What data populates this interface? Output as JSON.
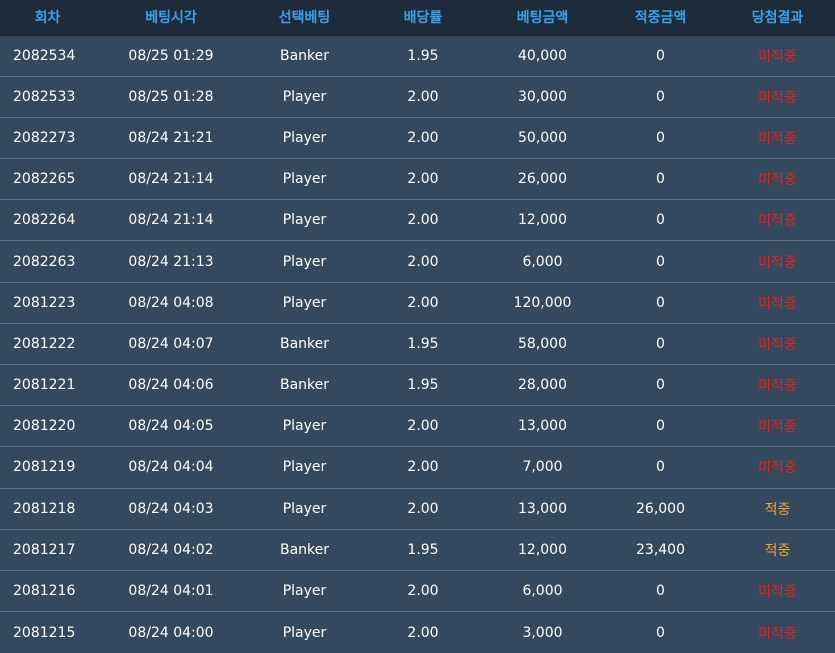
{
  "colors": {
    "header_text": "#3aa3e8",
    "header_bg": "#1d2b3b",
    "row_bg": "#34495e",
    "row_border": "#5d7285",
    "text": "#ffffff",
    "lose": "#e02424",
    "win": "#f0a52c"
  },
  "table": {
    "headers": [
      "회차",
      "베팅시각",
      "선택베팅",
      "배당률",
      "베팅금액",
      "적중금액",
      "당첨결과"
    ],
    "rows": [
      {
        "round": "2082534",
        "time": "08/25 01:29",
        "pick": "Banker",
        "odds": "1.95",
        "bet": "40,000",
        "win": "0",
        "result": "미적중",
        "status": "lose"
      },
      {
        "round": "2082533",
        "time": "08/25 01:28",
        "pick": "Player",
        "odds": "2.00",
        "bet": "30,000",
        "win": "0",
        "result": "미적중",
        "status": "lose"
      },
      {
        "round": "2082273",
        "time": "08/24 21:21",
        "pick": "Player",
        "odds": "2.00",
        "bet": "50,000",
        "win": "0",
        "result": "미적중",
        "status": "lose"
      },
      {
        "round": "2082265",
        "time": "08/24 21:14",
        "pick": "Player",
        "odds": "2.00",
        "bet": "26,000",
        "win": "0",
        "result": "미적중",
        "status": "lose"
      },
      {
        "round": "2082264",
        "time": "08/24 21:14",
        "pick": "Player",
        "odds": "2.00",
        "bet": "12,000",
        "win": "0",
        "result": "미적중",
        "status": "lose"
      },
      {
        "round": "2082263",
        "time": "08/24 21:13",
        "pick": "Player",
        "odds": "2.00",
        "bet": "6,000",
        "win": "0",
        "result": "미적중",
        "status": "lose"
      },
      {
        "round": "2081223",
        "time": "08/24 04:08",
        "pick": "Player",
        "odds": "2.00",
        "bet": "120,000",
        "win": "0",
        "result": "미적중",
        "status": "lose"
      },
      {
        "round": "2081222",
        "time": "08/24 04:07",
        "pick": "Banker",
        "odds": "1.95",
        "bet": "58,000",
        "win": "0",
        "result": "미적중",
        "status": "lose"
      },
      {
        "round": "2081221",
        "time": "08/24 04:06",
        "pick": "Banker",
        "odds": "1.95",
        "bet": "28,000",
        "win": "0",
        "result": "미적중",
        "status": "lose"
      },
      {
        "round": "2081220",
        "time": "08/24 04:05",
        "pick": "Player",
        "odds": "2.00",
        "bet": "13,000",
        "win": "0",
        "result": "미적중",
        "status": "lose"
      },
      {
        "round": "2081219",
        "time": "08/24 04:04",
        "pick": "Player",
        "odds": "2.00",
        "bet": "7,000",
        "win": "0",
        "result": "미적중",
        "status": "lose"
      },
      {
        "round": "2081218",
        "time": "08/24 04:03",
        "pick": "Player",
        "odds": "2.00",
        "bet": "13,000",
        "win": "26,000",
        "result": "적중",
        "status": "win"
      },
      {
        "round": "2081217",
        "time": "08/24 04:02",
        "pick": "Banker",
        "odds": "1.95",
        "bet": "12,000",
        "win": "23,400",
        "result": "적중",
        "status": "win"
      },
      {
        "round": "2081216",
        "time": "08/24 04:01",
        "pick": "Player",
        "odds": "2.00",
        "bet": "6,000",
        "win": "0",
        "result": "미적중",
        "status": "lose"
      },
      {
        "round": "2081215",
        "time": "08/24 04:00",
        "pick": "Player",
        "odds": "2.00",
        "bet": "3,000",
        "win": "0",
        "result": "미적중",
        "status": "lose"
      }
    ]
  }
}
